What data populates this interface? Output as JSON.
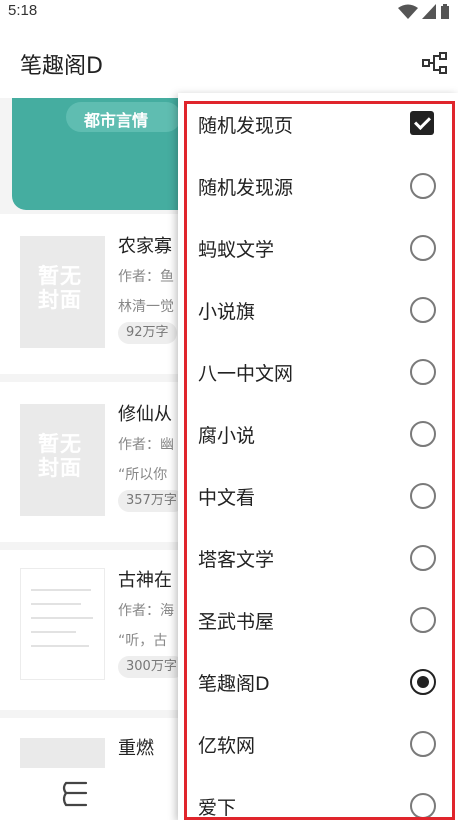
{
  "status_bar": {
    "time": "5:18"
  },
  "app_bar": {
    "title": "笔趣阁D"
  },
  "banner": {
    "label": "都市言情"
  },
  "cover_placeholder": "暂无封面",
  "books": [
    {
      "title": "农家寡",
      "author": "作者：鱼",
      "desc": "林清一觉",
      "tag": "92万字"
    },
    {
      "title": "修仙从",
      "author": "作者：幽",
      "desc": "“所以你",
      "tag": "357万字"
    },
    {
      "title": "古神在",
      "author": "作者：海",
      "desc": "“听，古",
      "tag": "300万字"
    },
    {
      "title": "重燃"
    }
  ],
  "menu": {
    "items": [
      {
        "label": "随机发现页",
        "control": "checkbox",
        "checked": true
      },
      {
        "label": "随机发现源",
        "control": "radio",
        "checked": false
      },
      {
        "label": "蚂蚁文学",
        "control": "radio",
        "checked": false
      },
      {
        "label": "小说旗",
        "control": "radio",
        "checked": false
      },
      {
        "label": "八一中文网",
        "control": "radio",
        "checked": false
      },
      {
        "label": "腐小说",
        "control": "radio",
        "checked": false
      },
      {
        "label": "中文看",
        "control": "radio",
        "checked": false
      },
      {
        "label": "塔客文学",
        "control": "radio",
        "checked": false
      },
      {
        "label": "圣武书屋",
        "control": "radio",
        "checked": false
      },
      {
        "label": "笔趣阁D",
        "control": "radio",
        "checked": true
      },
      {
        "label": "亿软网",
        "control": "radio",
        "checked": false
      },
      {
        "label": "爱下",
        "control": "radio",
        "checked": false
      }
    ]
  },
  "colors": {
    "accent": "#45ada0",
    "highlight": "#e0252c"
  },
  "icons": {
    "app_action": "source-tree-icon",
    "bottom_nav": "bookshelf-icon"
  }
}
